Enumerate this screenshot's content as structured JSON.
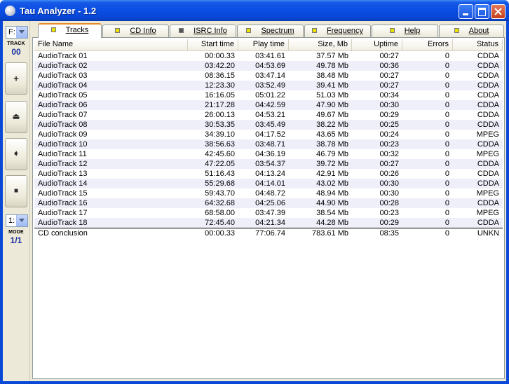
{
  "window": {
    "title": "Tau Analyzer - 1.2"
  },
  "left_panel": {
    "drive_value": "F:",
    "track_label": "TRACK",
    "track_value": "00",
    "buttons": [
      {
        "name": "add-button",
        "icon": "plus-icon",
        "glyph": "+"
      },
      {
        "name": "eject-button",
        "icon": "eject-icon",
        "glyph": "⏏"
      },
      {
        "name": "play-button",
        "icon": "arrow-right-icon",
        "glyph": "➧"
      },
      {
        "name": "stop-button",
        "icon": "stop-icon",
        "glyph": "■"
      }
    ],
    "mode_select_value": "1:",
    "mode_label": "MODE",
    "mode_value": "1/1"
  },
  "tabs": [
    {
      "label": "Tracks",
      "led": "yellow",
      "active": true
    },
    {
      "label": "CD Info",
      "led": "yellow"
    },
    {
      "label": "ISRC Info",
      "led": "gray"
    },
    {
      "label": "Spectrum",
      "led": "yellow"
    },
    {
      "label": "Frequency",
      "led": "yellow"
    },
    {
      "label": "Help",
      "led": "yellow"
    },
    {
      "label": "About",
      "led": "yellow"
    }
  ],
  "columns": [
    "File Name",
    "Start time",
    "Play time",
    "Size, Mb",
    "Uptime",
    "Errors",
    "Status"
  ],
  "rows": [
    [
      "AudioTrack 01",
      "00:00.33",
      "03:41.61",
      "37.57 Mb",
      "00:27",
      "0",
      "CDDA"
    ],
    [
      "AudioTrack 02",
      "03:42.20",
      "04:53.69",
      "49.78 Mb",
      "00:36",
      "0",
      "CDDA"
    ],
    [
      "AudioTrack 03",
      "08:36.15",
      "03:47.14",
      "38.48 Mb",
      "00:27",
      "0",
      "CDDA"
    ],
    [
      "AudioTrack 04",
      "12:23.30",
      "03:52.49",
      "39.41 Mb",
      "00:27",
      "0",
      "CDDA"
    ],
    [
      "AudioTrack 05",
      "16:16.05",
      "05:01.22",
      "51.03 Mb",
      "00:34",
      "0",
      "CDDA"
    ],
    [
      "AudioTrack 06",
      "21:17.28",
      "04:42.59",
      "47.90 Mb",
      "00:30",
      "0",
      "CDDA"
    ],
    [
      "AudioTrack 07",
      "26:00.13",
      "04:53.21",
      "49.67 Mb",
      "00:29",
      "0",
      "CDDA"
    ],
    [
      "AudioTrack 08",
      "30:53.35",
      "03:45.49",
      "38.22 Mb",
      "00:25",
      "0",
      "CDDA"
    ],
    [
      "AudioTrack 09",
      "34:39.10",
      "04:17.52",
      "43.65 Mb",
      "00:24",
      "0",
      "MPEG"
    ],
    [
      "AudioTrack 10",
      "38:56.63",
      "03:48.71",
      "38.78 Mb",
      "00:23",
      "0",
      "CDDA"
    ],
    [
      "AudioTrack 11",
      "42:45.60",
      "04:36.19",
      "46.79 Mb",
      "00:32",
      "0",
      "MPEG"
    ],
    [
      "AudioTrack 12",
      "47:22.05",
      "03:54.37",
      "39.72 Mb",
      "00:27",
      "0",
      "CDDA"
    ],
    [
      "AudioTrack 13",
      "51:16.43",
      "04:13.24",
      "42.91 Mb",
      "00:26",
      "0",
      "CDDA"
    ],
    [
      "AudioTrack 14",
      "55:29.68",
      "04:14.01",
      "43.02 Mb",
      "00:30",
      "0",
      "CDDA"
    ],
    [
      "AudioTrack 15",
      "59:43.70",
      "04:48.72",
      "48.94 Mb",
      "00:30",
      "0",
      "MPEG"
    ],
    [
      "AudioTrack 16",
      "64:32.68",
      "04:25.06",
      "44.90 Mb",
      "00:28",
      "0",
      "CDDA"
    ],
    [
      "AudioTrack 17",
      "68:58.00",
      "03:47.39",
      "38.54 Mb",
      "00:23",
      "0",
      "MPEG"
    ],
    [
      "AudioTrack 18",
      "72:45.40",
      "04:21.34",
      "44.28 Mb",
      "00:29",
      "0",
      "CDDA"
    ]
  ],
  "summary": [
    "CD conclusion",
    "00:00.33",
    "77:06.74",
    "783.61 Mb",
    "08:35",
    "0",
    "UNKN"
  ],
  "colors": {
    "title_blue": "#0a4ee3",
    "face": "#ece9d8",
    "row_alt": "#eeeff9",
    "active_tab_accent": "#e68b2c",
    "led_yellow": "#e9e000"
  }
}
